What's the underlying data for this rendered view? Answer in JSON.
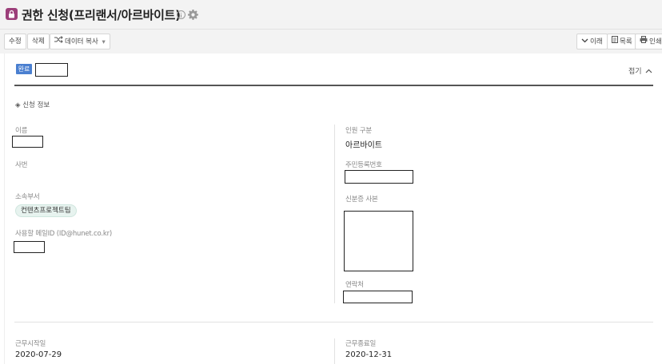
{
  "header": {
    "title": "권한 신청(프리랜서/아르바이트)",
    "brand_color": "#9c3f7a"
  },
  "toolbar": {
    "edit": "수정",
    "delete": "삭제",
    "copy_data": "데이터 복사",
    "next": "이래",
    "list": "목록",
    "print": "인쇄"
  },
  "form": {
    "status": "완료",
    "collapse": "접기",
    "section_title": "◈ 신청 정보",
    "fields": {
      "name_label": "이름",
      "employee_no_label": "사번",
      "dept_label": "소속부서",
      "dept_value": "컨텐츠프로젝트팀",
      "email_label": "사용할 메일ID (ID@hunet.co.kr)",
      "type_label": "인원 구분",
      "type_value": "아르바이트",
      "resident_no_label": "주민등록번호",
      "id_copy_label": "신분증 사본",
      "contact_label": "연락처",
      "start_label": "근무시작일",
      "start_value": "2020-07-29",
      "end_label": "근무종료일",
      "end_value": "2020-12-31"
    }
  },
  "colors": {
    "badge": "#4a7fd0",
    "chip_bg": "#e7f3ef"
  }
}
